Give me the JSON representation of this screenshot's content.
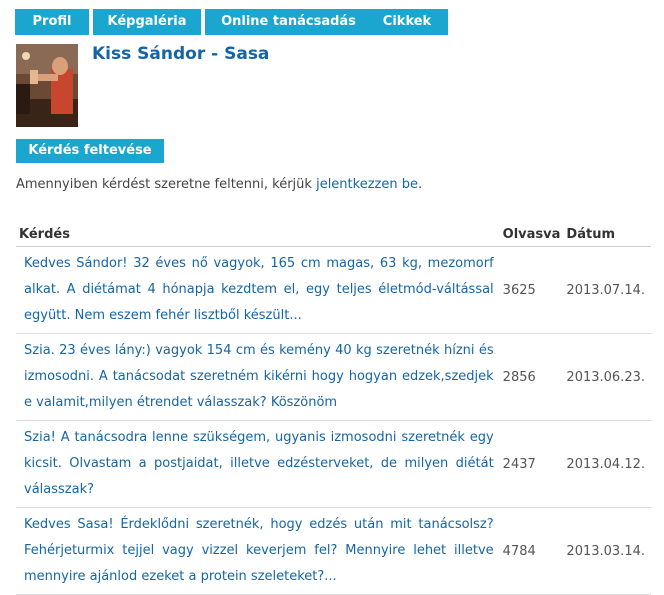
{
  "nav": {
    "tabs": [
      "Profil",
      "Képgaléria",
      "Online tanácsadás",
      "Cikkek"
    ]
  },
  "profile": {
    "name": "Kiss Sándor - Sasa"
  },
  "ask_button": "Kérdés feltevése",
  "info": {
    "prefix": "Amennyiben kérdést szeretne feltenni, kérjük ",
    "link": "jelentkezzen be",
    "suffix": "."
  },
  "table": {
    "headers": [
      "Kérdés",
      "Olvasva",
      "Dátum"
    ],
    "rows": [
      {
        "question": "Kedves Sándor! 32 éves nő vagyok, 165 cm magas, 63 kg, mezomorf alkat. A diétámat 4 hónapja kezdtem el, egy teljes életmód-váltással együtt. Nem eszem fehér lisztből készült...",
        "reads": "3625",
        "date": "2013.07.14."
      },
      {
        "question": "Szia. 23 éves lány:) vagyok 154 cm és kemény 40 kg szeretnék hízni és izmosodni. A tanácsodat szeretném kikérni hogy hogyan edzek,szedjek e valamit,milyen étrendet válasszak? Köszönöm",
        "reads": "2856",
        "date": "2013.06.23."
      },
      {
        "question": "Szia! A tanácsodra lenne szükségem, ugyanis izmosodni szeretnék egy kicsit. Olvastam a postjaidat, illetve edzésterveket, de milyen diétát válasszak?",
        "reads": "2437",
        "date": "2013.04.12."
      },
      {
        "question": "Kedves Sasa! Érdeklődni szeretnék, hogy edzés után mit tanácsolsz? Fehérjeturmix tejjel vagy vizzel keverjem fel? Mennyire lehet illetve mennyire ajánlod ezeket a protein szeleteket?...",
        "reads": "4784",
        "date": "2013.03.14."
      }
    ]
  }
}
